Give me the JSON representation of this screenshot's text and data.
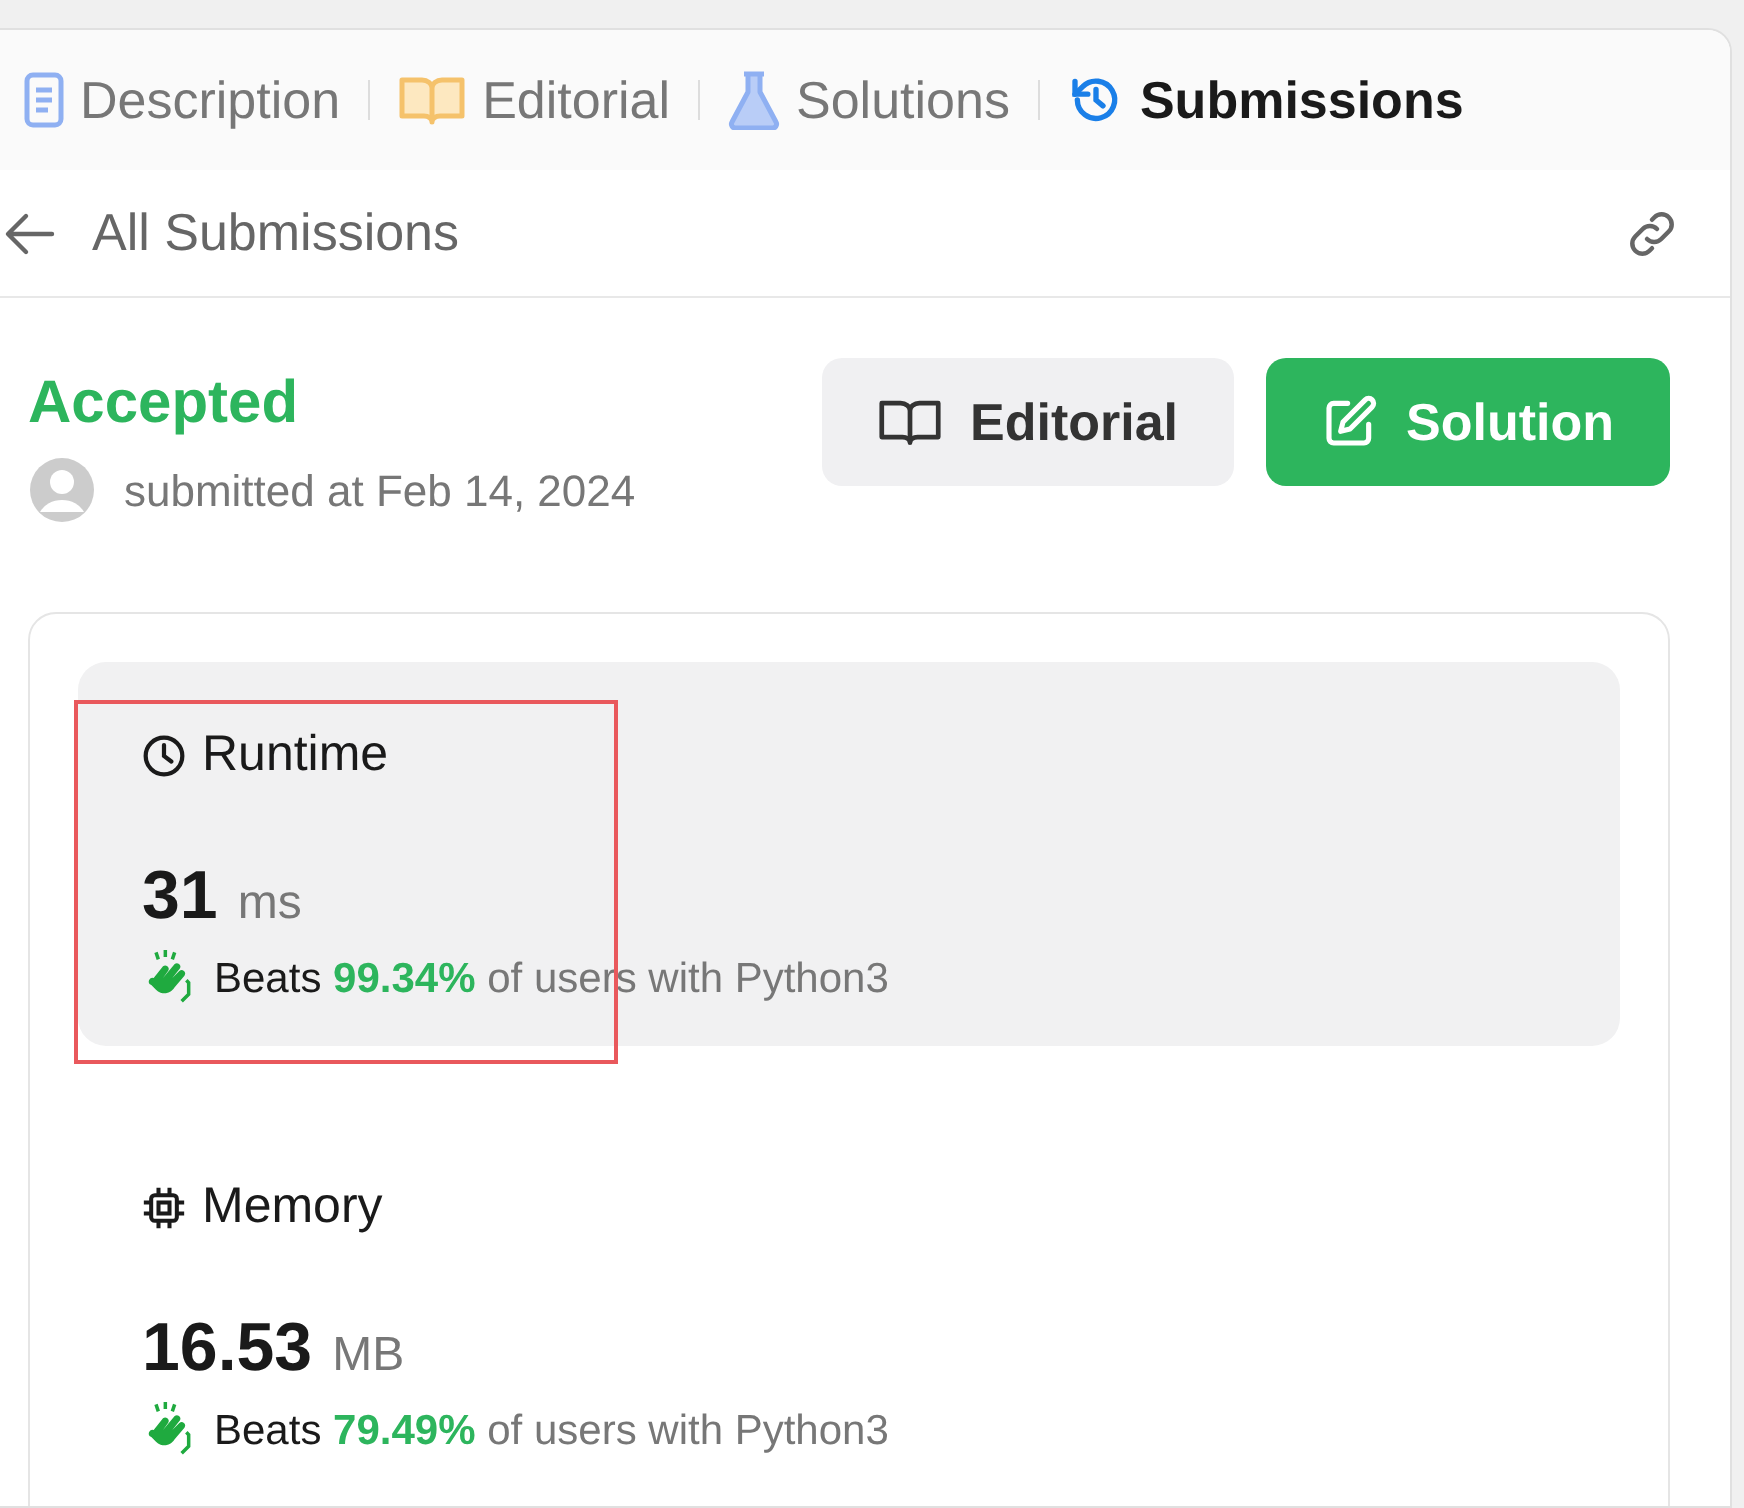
{
  "tabs": [
    {
      "label": "Description",
      "kind": "document",
      "selected": false
    },
    {
      "label": "Editorial",
      "kind": "book",
      "selected": false
    },
    {
      "label": "Solutions",
      "kind": "flask",
      "selected": false
    },
    {
      "label": "Submissions",
      "kind": "history",
      "selected": true
    }
  ],
  "header": {
    "back_label": "All Submissions"
  },
  "submission": {
    "status": "Accepted",
    "submitted": "submitted at Feb 14, 2024"
  },
  "buttons": [
    {
      "label": "Editorial",
      "kind": "secondary"
    },
    {
      "label": "Solution",
      "kind": "primary"
    }
  ],
  "metrics": [
    {
      "label": "Runtime",
      "kind": "clock",
      "value": "31",
      "unit": "ms",
      "beats_prefix": "Beats",
      "percent": "99.34%",
      "beats_suffix": "of users with Python3",
      "selected": true,
      "highlighted": true
    },
    {
      "label": "Memory",
      "kind": "chip",
      "value": "16.53",
      "unit": "MB",
      "beats_prefix": "Beats",
      "percent": "79.49%",
      "beats_suffix": "of users with Python3",
      "selected": false,
      "highlighted": false
    }
  ]
}
